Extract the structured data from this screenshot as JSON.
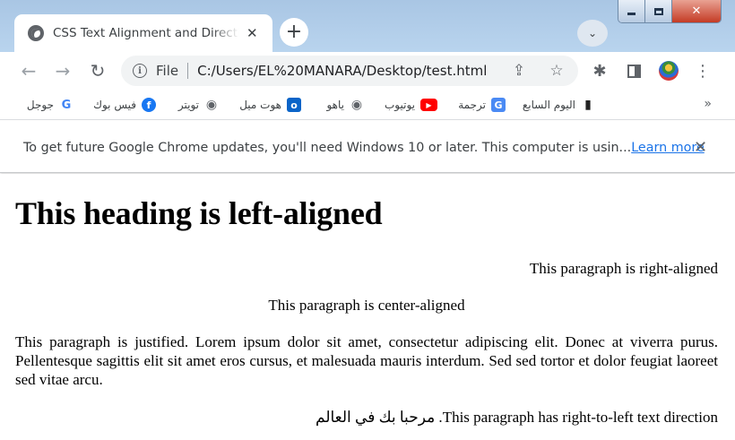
{
  "tab": {
    "title": "CSS Text Alignment and Direction",
    "close_glyph": "✕"
  },
  "new_tab_glyph": "+",
  "tab_search_glyph": "⌄",
  "window_controls": {
    "close_glyph": "✕"
  },
  "toolbar": {
    "back_glyph": "←",
    "forward_glyph": "→",
    "reload_glyph": "↻",
    "info_glyph": "i",
    "scheme": "File",
    "url": "C:/Users/EL%20MANARA/Desktop/test.html",
    "share_glyph": "⇪",
    "star_glyph": "☆",
    "extensions_glyph": "✱",
    "menu_glyph": "⋮"
  },
  "bookmarks": [
    {
      "label": "جوجل",
      "icon": "google-icon",
      "ico_text": "G",
      "color": "#4285f4"
    },
    {
      "label": "فيس بوك",
      "icon": "facebook-icon",
      "ico_text": "f",
      "color": "#1877f2"
    },
    {
      "label": "تويتر",
      "icon": "globe-icon",
      "ico_text": "◉",
      "color": "#5f6368"
    },
    {
      "label": "هوت ميل",
      "icon": "outlook-icon",
      "ico_text": "o",
      "color": "#0a64c8"
    },
    {
      "label": "ياهو",
      "icon": "globe-icon",
      "ico_text": "◉",
      "color": "#5f6368"
    },
    {
      "label": "يوتيوب",
      "icon": "youtube-icon",
      "ico_text": "▶",
      "color": "#ff0000"
    },
    {
      "label": "ترجمة",
      "icon": "translate-icon",
      "ico_text": "G",
      "color": "#4a8af4"
    },
    {
      "label": "اليوم السابع",
      "icon": "news-icon",
      "ico_text": "▮",
      "color": "#222222"
    }
  ],
  "bookmarks_more_glyph": "»",
  "infobar": {
    "message": "To get future Google Chrome updates, you'll need Windows 10 or later. This computer is usin...",
    "link": "Learn more",
    "close_glyph": "✕"
  },
  "page": {
    "heading": "This heading is left-aligned",
    "right_paragraph": "This paragraph is right-aligned",
    "center_paragraph": "This paragraph is center-aligned",
    "justified_paragraph": "This paragraph is justified. Lorem ipsum dolor sit amet, consectetur adipiscing elit. Donec at viverra purus. Pellentesque sagittis elit sit amet eros cursus, et malesuada mauris interdum. Sed sed tortor et dolor feugiat laoreet sed vitae arcu.",
    "rtl_paragraph": "This paragraph has right-to-left text direction. مرحبا بك في العالم"
  },
  "colors": {
    "frame": "#b9d4ee",
    "link": "#1a73e8",
    "close_button": "#c43b25"
  }
}
